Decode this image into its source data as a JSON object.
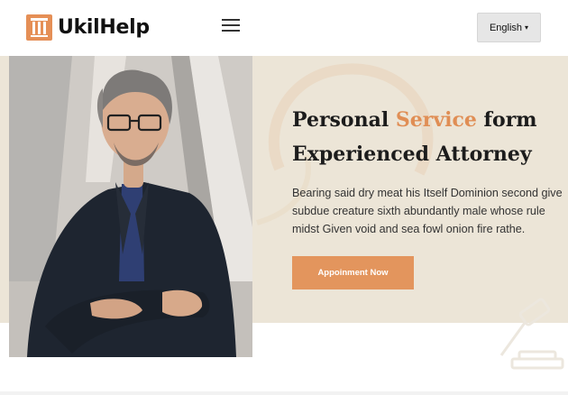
{
  "header": {
    "brand": "UkilHelp",
    "menu_icon": "hamburger-icon",
    "language_label": "English",
    "language_caret": "▾"
  },
  "hero": {
    "title_part1": "Personal ",
    "title_accent": "Service",
    "title_part2": " form",
    "title_line2": "Experienced Attorney",
    "description": "Bearing said dry meat his Itself Dominion second give subdue creature sixth abundantly male whose rule midst Given void and sea fowl onion fire rathe.",
    "cta_label": "Appoinment Now"
  },
  "colors": {
    "accent": "#e3955d",
    "hero_background": "#ece5d7"
  }
}
